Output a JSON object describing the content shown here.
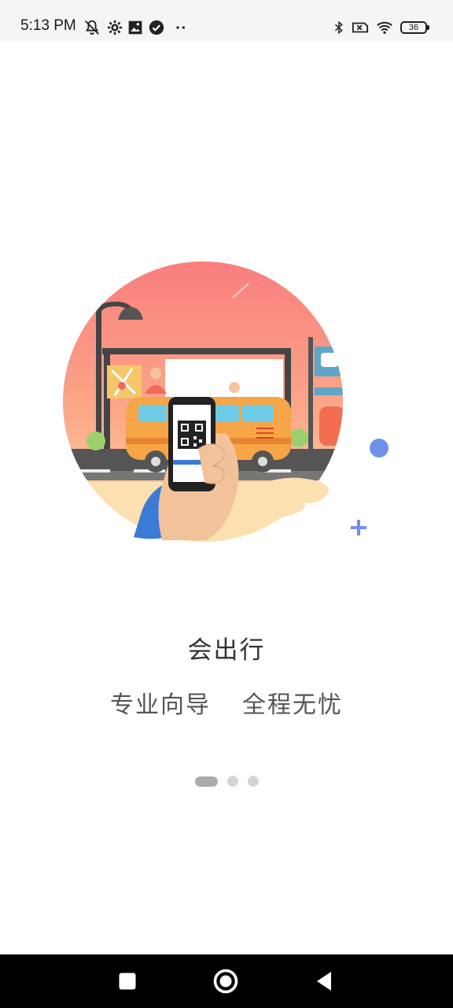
{
  "status_bar": {
    "time": "5:13 PM",
    "battery": "36",
    "icons": [
      "bell-off-icon",
      "gear-icon",
      "photo-icon",
      "check-circle-icon",
      "more-dots-icon",
      "bluetooth-icon",
      "sim-x-icon",
      "wifi-icon",
      "battery-icon"
    ]
  },
  "onboarding": {
    "title": "会出行",
    "subtitle_left": "专业向导",
    "subtitle_right": "全程无忧",
    "page_count": 3,
    "current_page": 1
  },
  "colors": {
    "circle_top": "#f97e7e",
    "circle_bottom": "#fcd6a6",
    "bus": "#f6a647",
    "accent_blue": "#6f90ea",
    "nav_bg": "#000000"
  },
  "nav_bar": {
    "icons": [
      "recents-square-icon",
      "home-circle-icon",
      "back-triangle-icon"
    ]
  }
}
